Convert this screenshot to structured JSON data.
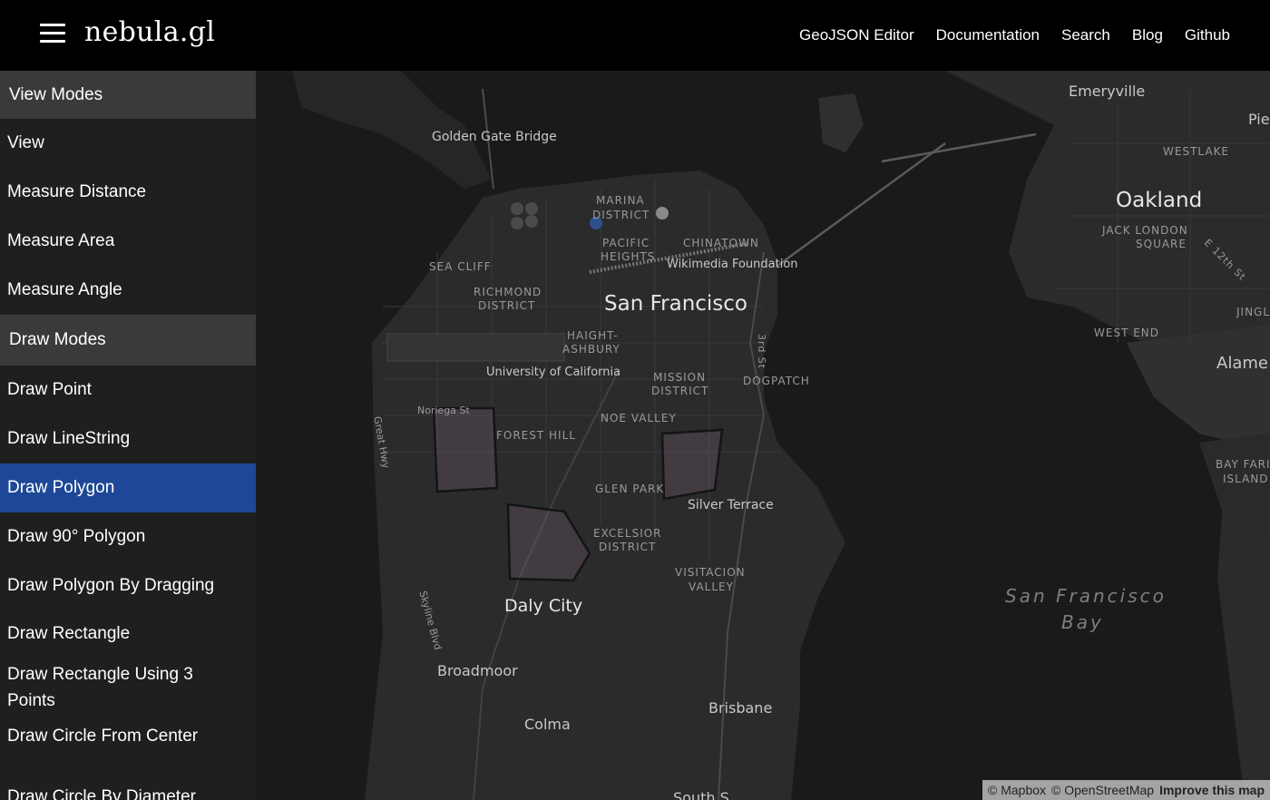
{
  "header": {
    "brand": "nebula.gl",
    "nav": [
      "GeoJSON Editor",
      "Documentation",
      "Search",
      "Blog",
      "Github"
    ]
  },
  "sidebar": {
    "view_section": "View Modes",
    "view_items": [
      "View",
      "Measure Distance",
      "Measure Area",
      "Measure Angle"
    ],
    "draw_section": "Draw Modes",
    "draw_items": [
      "Draw Point",
      "Draw LineString",
      "Draw Polygon",
      "Draw 90° Polygon",
      "Draw Polygon By Dragging",
      "Draw Rectangle",
      "Draw Rectangle Using 3 Points",
      "Draw Circle From Center",
      "Draw Circle By Diameter"
    ],
    "active_item": "Draw Polygon",
    "active_color": "#1e4897"
  },
  "map": {
    "labels": {
      "golden_gate": "Golden Gate Bridge",
      "marina": "MARINA",
      "marina2": "DISTRICT",
      "pacific": "PACIFIC",
      "pacific2": "HEIGHTS",
      "chinatown": "CHINATOWN",
      "wikimedia": "Wikimedia Foundation",
      "sea_cliff": "SEA CLIFF",
      "richmond": "RICHMOND",
      "richmond2": "DISTRICT",
      "san_francisco": "San Francisco",
      "haight": "HAIGHT-",
      "haight2": "ASHBURY",
      "ucsf": "University of California",
      "mission": "MISSION",
      "mission2": "DISTRICT",
      "dogpatch": "DOGPATCH",
      "third_st": "3rd St",
      "noriega": "Noriega St",
      "noe": "NOE VALLEY",
      "forest_hill": "FOREST HILL",
      "great_hwy": "Great Hwy",
      "glen_park": "GLEN PARK",
      "silver": "Silver Terrace",
      "excelsior": "EXCELSIOR",
      "excelsior2": "DISTRICT",
      "visitacion": "VISITACION",
      "visitacion2": "VALLEY",
      "daly_city": "Daly City",
      "skyline": "Skyline Blvd",
      "broadmoor": "Broadmoor",
      "brisbane": "Brisbane",
      "colma": "Colma",
      "emeryville": "Emeryville",
      "pie": "Pie",
      "westlake": "WESTLAKE",
      "oakland": "Oakland",
      "jack_london": "JACK LONDON",
      "jack_london2": "SQUARE",
      "e12th": "E 12th St",
      "jingl": "JINGL",
      "west_end": "WEST END",
      "alameda": "Alame",
      "bay_farm": "BAY FARI",
      "bay_farm2": "ISLAND",
      "sf_bay": "San Francisco",
      "sf_bay2": "Bay",
      "south_sf": "South S"
    },
    "attribution": {
      "mapbox": "© Mapbox",
      "osm": "© OpenStreetMap",
      "improve": "Improve this map"
    }
  }
}
